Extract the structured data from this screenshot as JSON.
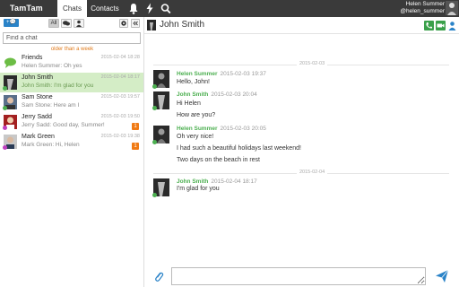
{
  "app": {
    "brand": "TamTam"
  },
  "nav": {
    "tabs": [
      {
        "label": "Chats",
        "active": true
      },
      {
        "label": "Contacts",
        "active": false
      }
    ],
    "icons": [
      "bell-icon",
      "bolt-icon",
      "search-icon"
    ]
  },
  "user": {
    "name": "Helen Summer",
    "handle": "@helen_summer"
  },
  "sidebar": {
    "new_chat_label": "+💬",
    "filters": {
      "all": "All"
    },
    "search_placeholder": "Find a chat",
    "older_label": "older than a week",
    "chats": [
      {
        "name": "Friends",
        "preview": "Helen Summer: Oh yes",
        "time": "2015-02-04 18:28",
        "badge": "",
        "selected": false,
        "type": "group"
      },
      {
        "name": "John Smith",
        "preview": "John Smith: I'm glad for you",
        "time": "2015-02-04 18:17",
        "badge": "",
        "selected": true,
        "status": "#4caf50"
      },
      {
        "name": "Sam Stone",
        "preview": "Sam Stone: Here am I",
        "time": "2015-02-03 19:57",
        "badge": "",
        "selected": false,
        "status": "#4caf50"
      },
      {
        "name": "Jerry Sadd",
        "preview": "Jerry Sadd: Good day, Summer!",
        "time": "2015-02-03 19:50",
        "badge": "1",
        "selected": false,
        "status": "#c040c0"
      },
      {
        "name": "Mark Green",
        "preview": "Mark Green: Hi, Helen",
        "time": "2015-02-03 19:38",
        "badge": "1",
        "selected": false,
        "status": "#c040c0"
      }
    ]
  },
  "chat": {
    "title": "John Smith",
    "dates": [
      "2015-02-03",
      "2015-02-04"
    ],
    "messages": [
      {
        "author": "Helen Summer",
        "time": "2015-02-03 19:37",
        "color": "#4caf50",
        "lines": [
          "Hello, John!"
        ]
      },
      {
        "author": "John Smith",
        "time": "2015-02-03 20:04",
        "color": "#4caf50",
        "lines": [
          "Hi Helen",
          "How are you?"
        ]
      },
      {
        "author": "Helen Summer",
        "time": "2015-02-03 20:05",
        "color": "#4caf50",
        "lines": [
          "Oh very nice!",
          "I had such a beautiful holidays last weekend!",
          "Two days on the beach in rest"
        ]
      },
      {
        "author": "John Smith",
        "time": "2015-02-04 18:17",
        "color": "#4caf50",
        "lines": [
          "I'm glad for you"
        ]
      }
    ]
  },
  "colors": {
    "accent": "#2a83c8",
    "online": "#4caf50",
    "badge": "#f07a14",
    "selected": "#d4edc6"
  }
}
